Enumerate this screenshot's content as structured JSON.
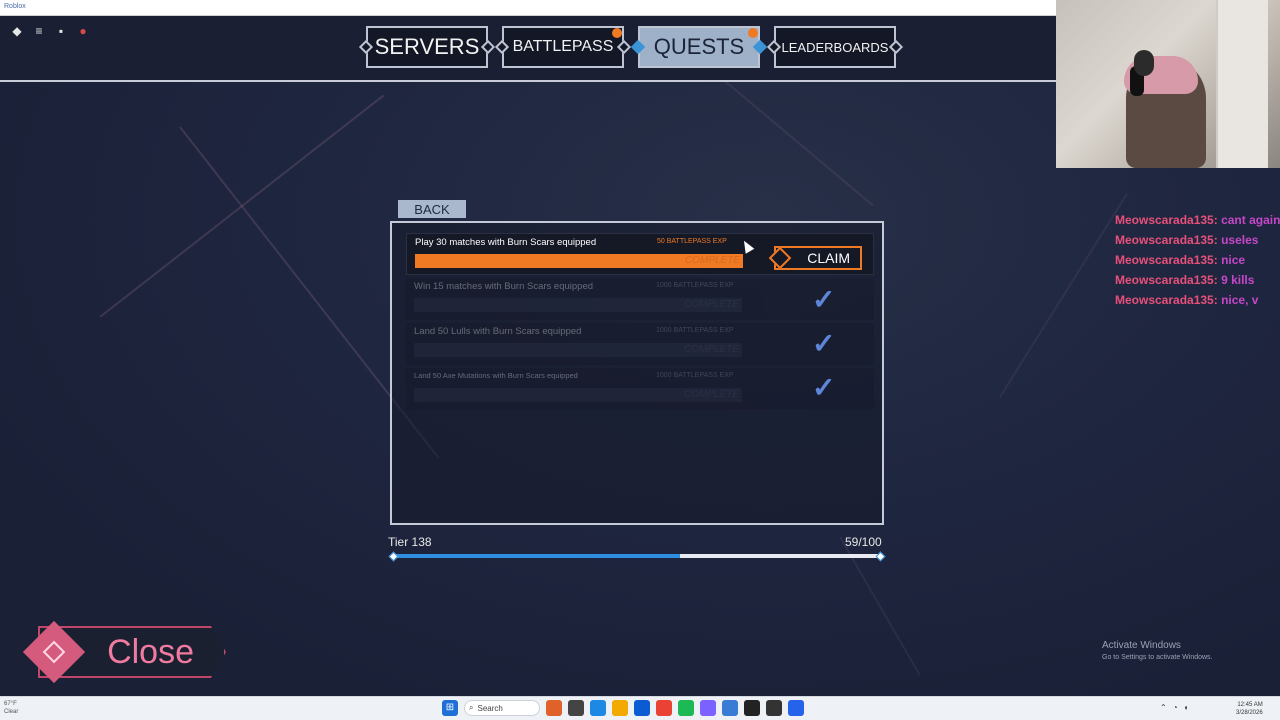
{
  "browser": {
    "app_name": "Roblox"
  },
  "top_nav": {
    "tabs": [
      {
        "label": "SERVERS",
        "active": false,
        "notification": false
      },
      {
        "label": "BATTLEPASS",
        "active": false,
        "notification": true
      },
      {
        "label": "QUESTS",
        "active": true,
        "notification": true
      },
      {
        "label": "LEADERBOARDS",
        "active": false,
        "notification": false
      }
    ]
  },
  "quests_panel": {
    "back_label": "BACK",
    "quests": [
      {
        "title": "Play 30 matches with Burn Scars equipped",
        "reward": "50 BATTLEPASS EXP",
        "status": "COMPLETE",
        "claimable": true
      },
      {
        "title": "Win 15 matches with Burn Scars equipped",
        "reward": "1000 BATTLEPASS EXP",
        "status": "COMPLETE",
        "claimable": false
      },
      {
        "title": "Land 50 Lulls with Burn Scars equipped",
        "reward": "1000 BATTLEPASS EXP",
        "status": "COMPLETE",
        "claimable": false
      },
      {
        "title": "Land 50 Axe Mutations with Burn Scars equipped",
        "reward": "1000 BATTLEPASS EXP",
        "status": "COMPLETE",
        "claimable": false
      }
    ],
    "claim_label": "CLAIM",
    "check_glyph": "✓"
  },
  "tier": {
    "label": "Tier 138",
    "progress_text": "59/100",
    "progress_fraction": 0.59
  },
  "close_label": "Close",
  "watermark": {
    "line1": "Activate Windows",
    "line2": "Go to Settings to activate Windows."
  },
  "chat": [
    {
      "user": "Meowscarada135:",
      "text": "cant against that"
    },
    {
      "user": "Meowscarada135:",
      "text": "useles"
    },
    {
      "user": "Meowscarada135:",
      "text": "nice"
    },
    {
      "user": "Meowscarada135:",
      "text": "9 kills"
    },
    {
      "user": "Meowscarada135:",
      "text": "nice, v"
    }
  ],
  "taskbar": {
    "weather_line1": "67°F",
    "weather_line2": "Clear",
    "search_label": "Search",
    "clock_time": "12:45 AM",
    "clock_date": "3/28/2026"
  },
  "colors": {
    "accent_orange": "#f07a24",
    "tab_active": "#9fb1c9",
    "progress_blue": "#2f8ee0",
    "close_pink": "#d55b7e",
    "check_blue": "#5d86d8"
  },
  "icons": [
    "roblox-logo-icon",
    "menu-icon",
    "chat-icon",
    "mic-icon",
    "claim-diamond-icon",
    "check-icon",
    "close-diamond-icon",
    "windows-start-icon",
    "search-icon"
  ]
}
